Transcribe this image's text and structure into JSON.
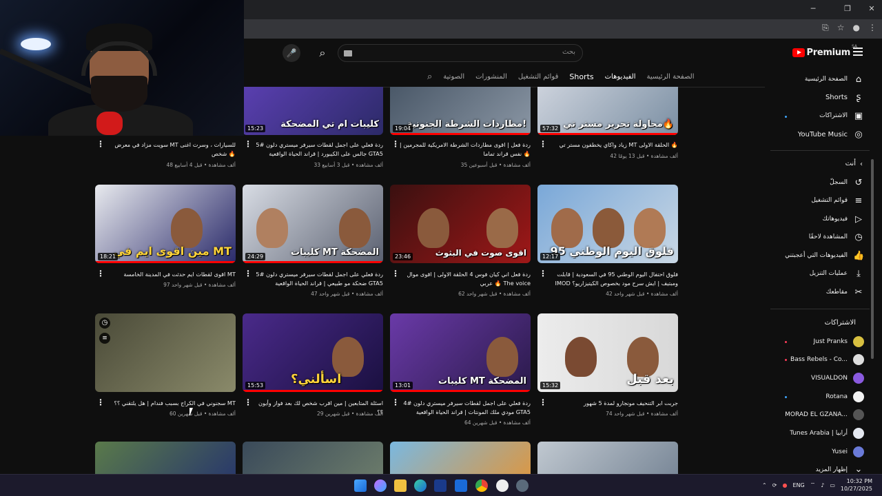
{
  "masthead": {
    "search_placeholder": "بحث",
    "logo_text": "Premium",
    "country": "SA"
  },
  "tabs": [
    {
      "label": "الصفحة الرئيسية",
      "active": false
    },
    {
      "label": "الفيديوهات",
      "active": true
    },
    {
      "label": "Shorts",
      "active": false
    },
    {
      "label": "قوائم التشغيل",
      "active": false
    },
    {
      "label": "المنشورات",
      "active": false
    },
    {
      "label": "الصوتية",
      "active": false
    }
  ],
  "sidebar": {
    "main": [
      "الصفحة الرئيسية",
      "Shorts",
      "الاشتراكات",
      "YouTube Music"
    ],
    "you_heading": "أنت",
    "you_items": [
      "السجلّ",
      "قوائم التشغيل",
      "فيديوهاتك",
      "المشاهدة لاحقًا",
      "الفيديوهات التي أعجبتني",
      "عمليات التنزيل",
      "مقاطعك"
    ],
    "subs_heading": "الاشتراكات",
    "subs": [
      "Just Pranks",
      "Bass Rebels - Co...",
      "VISUALDON",
      "Rotana",
      "MORAD EL GZANA...",
      "Tunes Arabia | أرابيا",
      "Yusei",
      "إظهار المزيد"
    ]
  },
  "videos": [
    {
      "title": "زياد واكاي يخطفون مستر تي MT الحلقة الاولى 🔥",
      "meta": "42 ألف مشاهدة • قبل 13 يومًا",
      "duration": "57:32",
      "thumb_text": "محاولة تحرير مستر تي🔥"
    },
    {
      "title": "ردة فعل | اقوى مطاردات الشرطة الامريكية للمجرمين | نفس قراند تماما 🔥",
      "meta": "35 ألف مشاهدة • قبل أسبوعين",
      "duration": "19:04",
      "thumb_text": "مطاردات الشرطة الجنونية!"
    },
    {
      "title": "ردة فعلي على اجمل لقطات سيرفر ميستري دلون #5 جالس على الكيبورد | قراند الحياة الواقعية GTA5",
      "meta": "33 ألف مشاهدة • قبل 3 أسابيع",
      "duration": "15:23",
      "thumb_text": "كليبات ام تي المضحكة"
    },
    {
      "title": "سويت مزاد في معرض MT للسيارات ، وسرت اغنى شخص 🔥",
      "meta": "48 ألف مشاهدة • قبل 4 أسابيع",
      "duration": "",
      "thumb_text": ""
    },
    {
      "title": "فلوق احتفال اليوم الوطني 95 في السعودية | قابلت IMOD ومبتيف | ايش سرح مود بخصوص الكيتيزاريو؟",
      "meta": "42 ألف مشاهدة • قبل شهر واحد",
      "duration": "12:17",
      "thumb_text": "فلوق اليوم الوطني 95"
    },
    {
      "title": "ردة فعل اني كيان فوس 4 الحلقة الاولى | اقوى موال عربي 🔥 The voice",
      "meta": "62 ألف مشاهدة • قبل شهر واحد",
      "duration": "23:46",
      "thumb_text": "اقوى صوت في البثوث"
    },
    {
      "title": "ردة فعلي على اجمل لقطات سيرفر ميستري دلون #5 ضحكة مو طبيعي | قراند الحياة الواقعية GTA5",
      "meta": "47 ألف مشاهدة • قبل شهر واحد",
      "duration": "24:29",
      "thumb_text": "كليبات MT المضحكة"
    },
    {
      "title": "اقوى لقطات ايم حدثت في المدينة الخامسة MT",
      "meta": "97 ألف مشاهدة • قبل شهر واحد",
      "duration": "18:21",
      "thumb_text": "مين اقوى ايم في MT"
    },
    {
      "title": "جربت ابر التنحيف مونجارو لمدة 5 شهور",
      "meta": "74 ألف مشاهدة • قبل شهر واحد",
      "duration": "15:32",
      "thumb_text": "بعد  قبل"
    },
    {
      "title": "ردة فعلي على اجمل لقطات سيرفر ميستري دلون #4 مودي ملك المونتات | قراند الحياة الواقعية GTA5",
      "meta": "64 ألف مشاهدة • قبل شهرين",
      "duration": "13:01",
      "thumb_text": "كليبات MT المضحكة"
    },
    {
      "title": "اسئلة المتابعين | مين اقرب شخص لك بعد فواز وأيون ؟؟",
      "meta": "29 ألف مشاهدة • قبل شهرين",
      "duration": "15:53",
      "thumb_text": "اسألني؟"
    },
    {
      "title": "سجنوني في الكراج بسبب فندام | هل يلتقني ؟؟ MT",
      "meta": "60 ألف مشاهدة • قبل شهرين",
      "duration": "",
      "thumb_text": ""
    }
  ],
  "taskbar": {
    "lang": "ENG",
    "time": "10:32 PM",
    "date": "10/27/2025"
  },
  "colors": {
    "bg": "#0f0f0f",
    "accent": "#ff0000",
    "taskbar": "#1c1a2c"
  }
}
